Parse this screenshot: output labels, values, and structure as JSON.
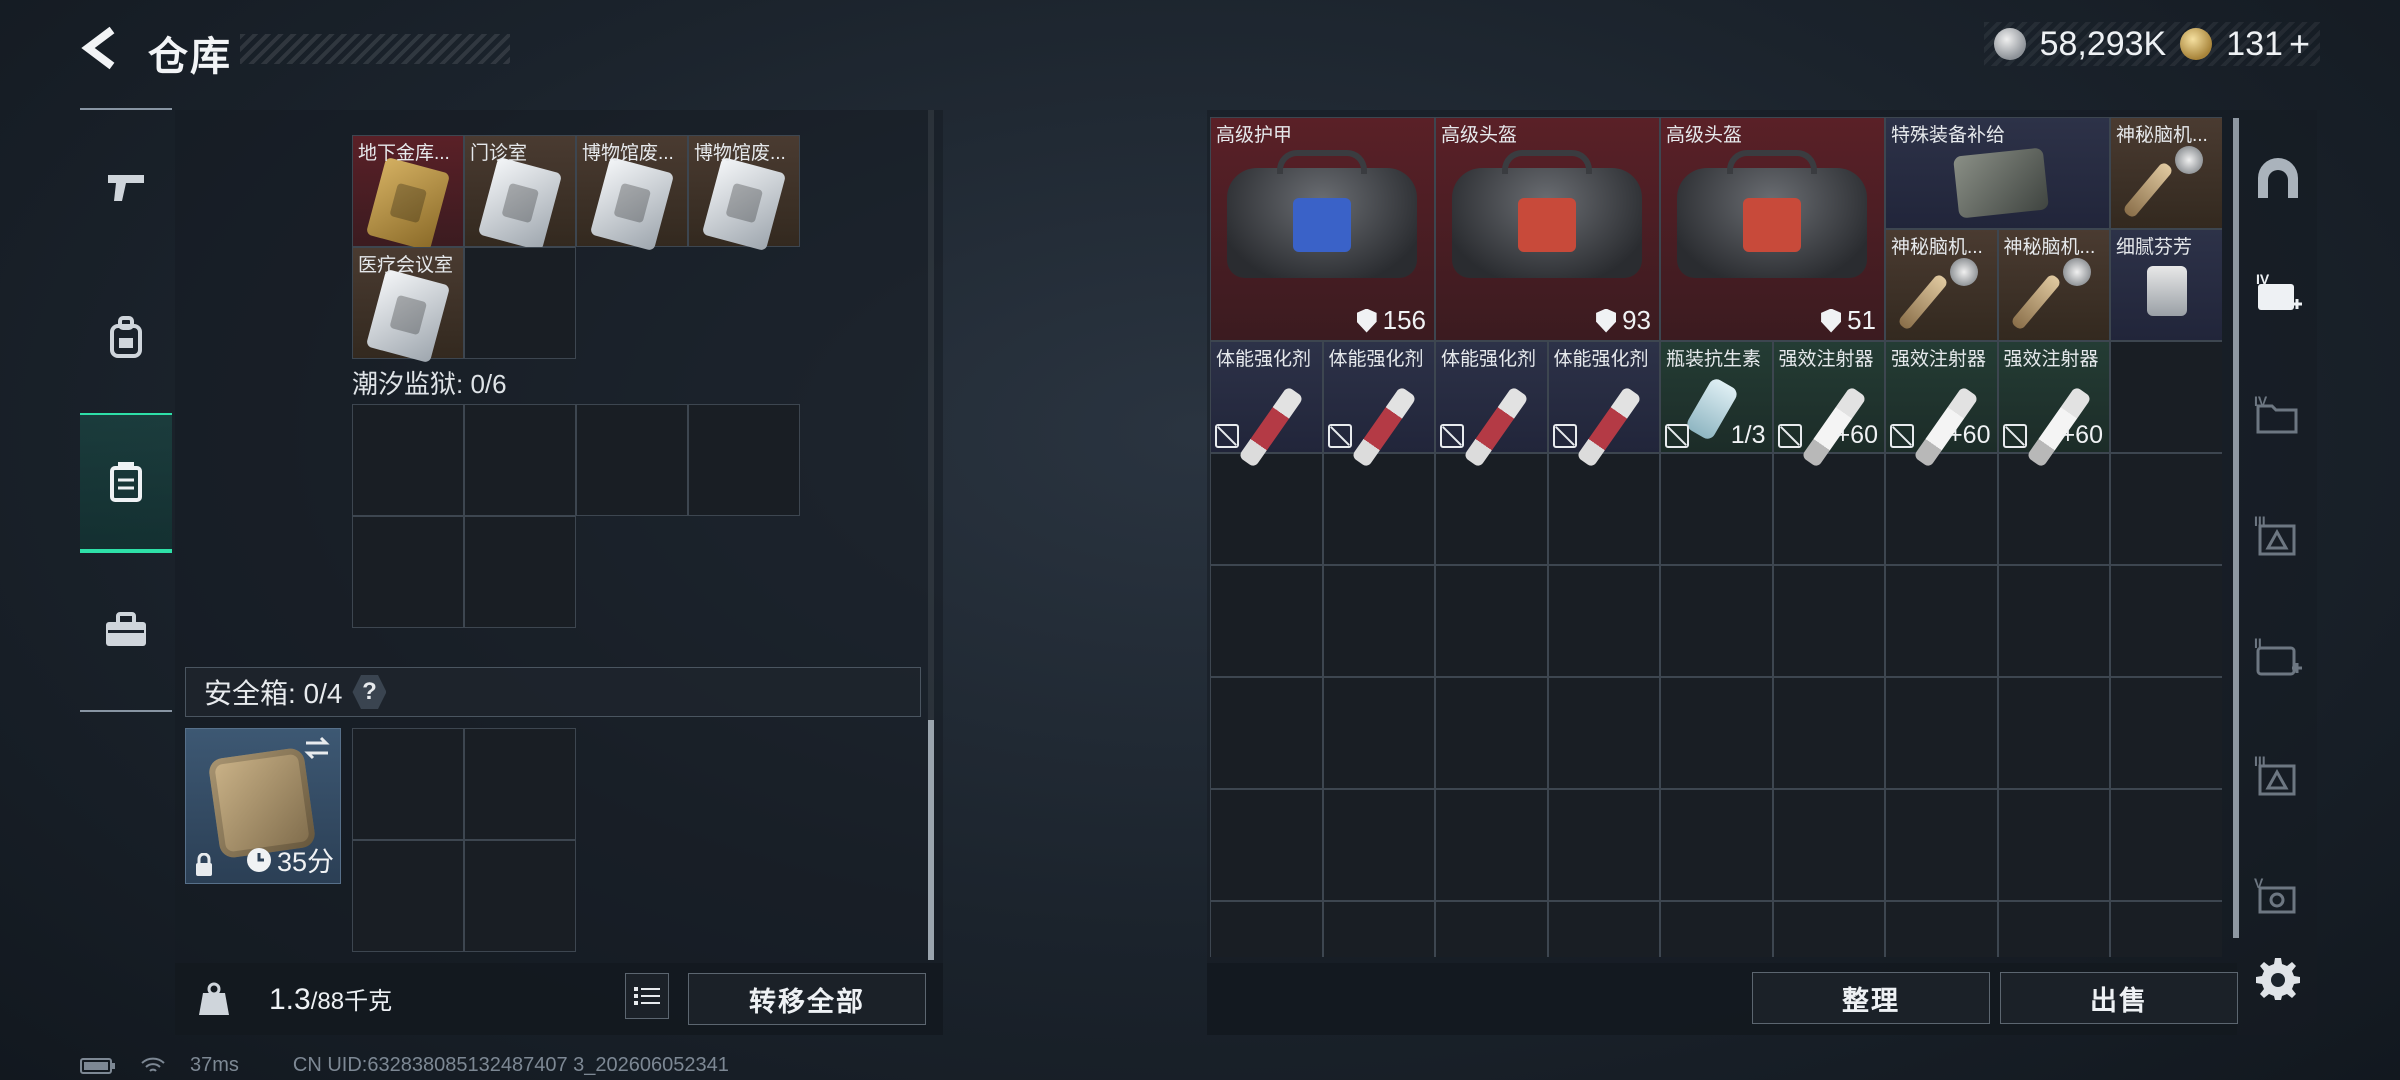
{
  "header": {
    "title": "仓库",
    "silver_amount": "58,293K",
    "gold_amount": "131",
    "gold_plus": "+"
  },
  "left_rail": {
    "items": [
      {
        "icon": "pistol-icon"
      },
      {
        "icon": "backpack-icon"
      },
      {
        "icon": "container-icon",
        "active": true
      },
      {
        "icon": "toolbox-icon"
      }
    ]
  },
  "keycards": {
    "cells": [
      "地下金库...",
      "门诊室",
      "博物馆废...",
      "博物馆废...",
      "医疗会议室"
    ]
  },
  "tide_prison": {
    "label": "潮汐监狱: 0/6"
  },
  "safebox": {
    "label": "安全箱: 0/4",
    "help": "?",
    "timer": "35分"
  },
  "bottom_left": {
    "weight_current": "1.3",
    "weight_max": "/88千克",
    "transfer_all": "转移全部"
  },
  "stash": {
    "row1": [
      {
        "label": "高级护甲",
        "value": "156",
        "color": "red"
      },
      {
        "label": "高级头盔",
        "value": "93",
        "color": "red"
      },
      {
        "label": "高级头盔",
        "value": "51",
        "color": "red"
      },
      {
        "label": "特殊装备补给",
        "color": "navy"
      },
      {
        "label": "神秘脑机...",
        "color": "brown"
      }
    ],
    "row2": [
      {
        "label": "神秘脑机...",
        "color": "brown"
      },
      {
        "label": "神秘脑机...",
        "color": "brown"
      },
      {
        "label": "细腻芬芳",
        "color": "navy"
      }
    ],
    "row3": [
      {
        "label": "体能强化剂",
        "qty": "",
        "color": "navy"
      },
      {
        "label": "体能强化剂",
        "qty": "",
        "color": "navy"
      },
      {
        "label": "体能强化剂",
        "qty": "",
        "color": "navy"
      },
      {
        "label": "体能强化剂",
        "qty": "",
        "color": "navy"
      },
      {
        "label": "瓶装抗生素",
        "qty": "1/3",
        "color": "green"
      },
      {
        "label": "强效注射器",
        "qty": "+60",
        "color": "green"
      },
      {
        "label": "强效注射器",
        "qty": "+60",
        "color": "green"
      },
      {
        "label": "强效注射器",
        "qty": "+60",
        "color": "green"
      }
    ]
  },
  "bottom_right": {
    "sort": "整理",
    "sell": "出售"
  },
  "right_rail": {
    "labels": [
      "IV",
      "IV",
      "III",
      "II",
      "III",
      "V"
    ]
  },
  "status_bar": {
    "ping": "37ms",
    "uid": "CN UID:632838085132487407 3_202606052341"
  },
  "colors": {
    "accent": "#2ee0a8",
    "red_item": "#5a2027",
    "navy_item": "#2d3248",
    "brown_item": "#4a3b31",
    "green_item": "#243c34"
  }
}
